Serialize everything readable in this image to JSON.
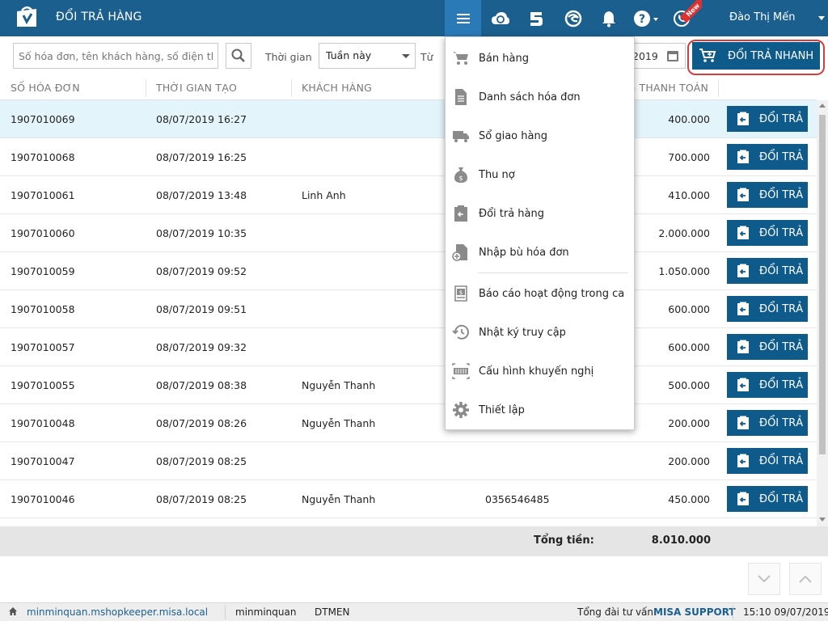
{
  "header": {
    "title": "ĐỔI TRẢ HÀNG",
    "user_name": "Đào Thị Mến",
    "new_badge": "New"
  },
  "filters": {
    "search_placeholder": "Số hóa đơn, tên khách hàng, số điện thoại",
    "time_label": "Thời gian",
    "period_value": "Tuần này",
    "from_label": "Từ",
    "date_to_value": "2019",
    "quick_return_label": "ĐỔI TRẢ NHANH"
  },
  "table": {
    "columns": [
      "SỐ HÓA ĐƠN",
      "THỜI GIAN TẠO",
      "KHÁCH HÀNG",
      "G THANH TOÁN"
    ],
    "return_label": "ĐỔI TRẢ",
    "rows": [
      {
        "invoice": "1907010069",
        "time": "08/07/2019 16:27",
        "customer": "",
        "phone": "",
        "amount": "400.000"
      },
      {
        "invoice": "1907010068",
        "time": "08/07/2019 16:25",
        "customer": "",
        "phone": "",
        "amount": "700.000"
      },
      {
        "invoice": "1907010061",
        "time": "08/07/2019 13:48",
        "customer": "Linh Anh",
        "phone": "",
        "amount": "410.000"
      },
      {
        "invoice": "1907010060",
        "time": "08/07/2019 10:35",
        "customer": "",
        "phone": "",
        "amount": "2.000.000"
      },
      {
        "invoice": "1907010059",
        "time": "08/07/2019 09:52",
        "customer": "",
        "phone": "",
        "amount": "1.050.000"
      },
      {
        "invoice": "1907010058",
        "time": "08/07/2019 09:51",
        "customer": "",
        "phone": "",
        "amount": "600.000"
      },
      {
        "invoice": "1907010057",
        "time": "08/07/2019 09:32",
        "customer": "",
        "phone": "",
        "amount": "600.000"
      },
      {
        "invoice": "1907010055",
        "time": "08/07/2019 08:38",
        "customer": "Nguyễn Thanh",
        "phone": "",
        "amount": "500.000"
      },
      {
        "invoice": "1907010048",
        "time": "08/07/2019 08:26",
        "customer": "Nguyễn Thanh",
        "phone": "",
        "amount": "200.000"
      },
      {
        "invoice": "1907010047",
        "time": "08/07/2019 08:25",
        "customer": "",
        "phone": "",
        "amount": "200.000"
      },
      {
        "invoice": "1907010046",
        "time": "08/07/2019 08:25",
        "customer": "Nguyễn Thanh",
        "phone": "0356546485",
        "amount": "450.000"
      }
    ]
  },
  "totals": {
    "label": "Tổng tiền:",
    "value": "8.010.000"
  },
  "menu": {
    "items": [
      {
        "label": "Bán hàng",
        "icon": "cart-icon"
      },
      {
        "label": "Danh sách hóa đơn",
        "icon": "document-icon"
      },
      {
        "label": "Sổ giao hàng",
        "icon": "truck-icon"
      },
      {
        "label": "Thu nợ",
        "icon": "money-bag-icon"
      },
      {
        "label": "Đổi trả hàng",
        "icon": "return-clipboard-icon"
      },
      {
        "label": "Nhập bù hóa đơn",
        "icon": "document-add-icon"
      },
      {
        "label": "Báo cáo hoạt động trong ca",
        "icon": "cash-report-icon"
      },
      {
        "label": "Nhật ký truy cập",
        "icon": "history-icon"
      },
      {
        "label": "Cấu hình khuyến nghị",
        "icon": "barcode-config-icon"
      },
      {
        "label": "Thiết lập",
        "icon": "gear-icon"
      }
    ]
  },
  "statusbar": {
    "site": "minminquan.mshopkeeper.misa.local",
    "username": "minminquan",
    "store_code": "DTMEN",
    "support_label": "Tổng đài tư vấn:",
    "support_brand": "MISA SUPPORT",
    "datetime": "15:10 09/07/2019"
  },
  "colors": {
    "header_bg": "#1b5f8f",
    "button_bg": "#0e5a8a",
    "selected_row_bg": "#e3f4fb",
    "highlight_outline": "#d63c3c"
  }
}
